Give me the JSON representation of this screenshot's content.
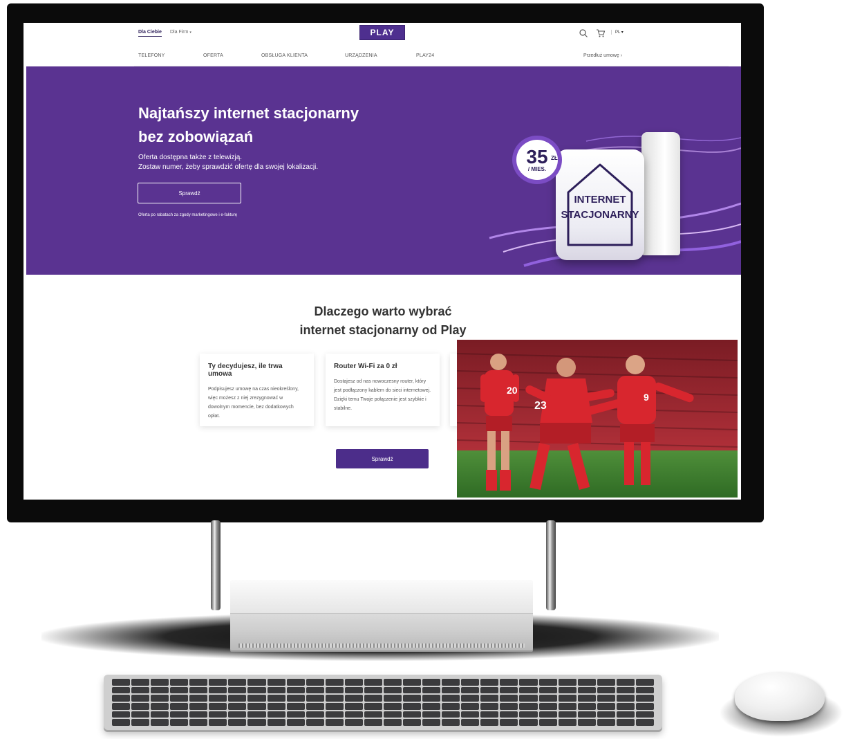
{
  "header": {
    "segment_private": "Dla Ciebie",
    "segment_business": "Dla Firm",
    "logo": "PLAY",
    "language": "PL",
    "icons": [
      "search-icon",
      "cart-icon"
    ]
  },
  "nav": {
    "items": [
      {
        "label": "TELEFONY"
      },
      {
        "label": "OFERTA"
      },
      {
        "label": "OBSŁUGA KLIENTA"
      },
      {
        "label": "URZĄDZENIA"
      },
      {
        "label": "PLAY24"
      }
    ],
    "extend_contract": "Przedłuż umowę"
  },
  "hero": {
    "title_line1": "Najtańszy internet stacjonarny",
    "title_line2": "bez zobowiązań",
    "text_line1": "Oferta dostępna także z telewizją.",
    "text_line2": "Zostaw numer, żeby sprawdzić ofertę dla swojej lokalizacji.",
    "button": "Sprawdź",
    "note": "Oferta po rabatach za zgody marketingowe i e-fakturę",
    "price_value": "35",
    "price_currency": "ZŁ",
    "price_unit": "/ MIES.",
    "product_line1": "INTERNET",
    "product_line2": "STACJONARNY"
  },
  "why": {
    "title_line1": "Dlaczego warto wybrać",
    "title_line2": "internet stacjonarny od Play",
    "cards": [
      {
        "title": "Ty decydujesz, ile trwa umowa",
        "text": "Podpisujesz umowę na czas nieokreślony, więc możesz z niej zrezygnować w dowolnym momencie, bez dodatkowych opłat."
      },
      {
        "title": "Router Wi-Fi za 0 zł",
        "text": "Dostajesz od nas nowoczesny router, który jest podłączony kablem do sieci internetowej. Dzięki temu Twoje połączenie jest szybkie i stabilne."
      }
    ],
    "button": "Sprawdź"
  },
  "photo": {
    "jersey_numbers": [
      "20",
      "23",
      "9"
    ]
  },
  "colors": {
    "brand_purple": "#5a3391",
    "button_purple": "#4c2d8a",
    "logo_purple": "#4e2f8f",
    "jersey_red": "#d8262e"
  }
}
